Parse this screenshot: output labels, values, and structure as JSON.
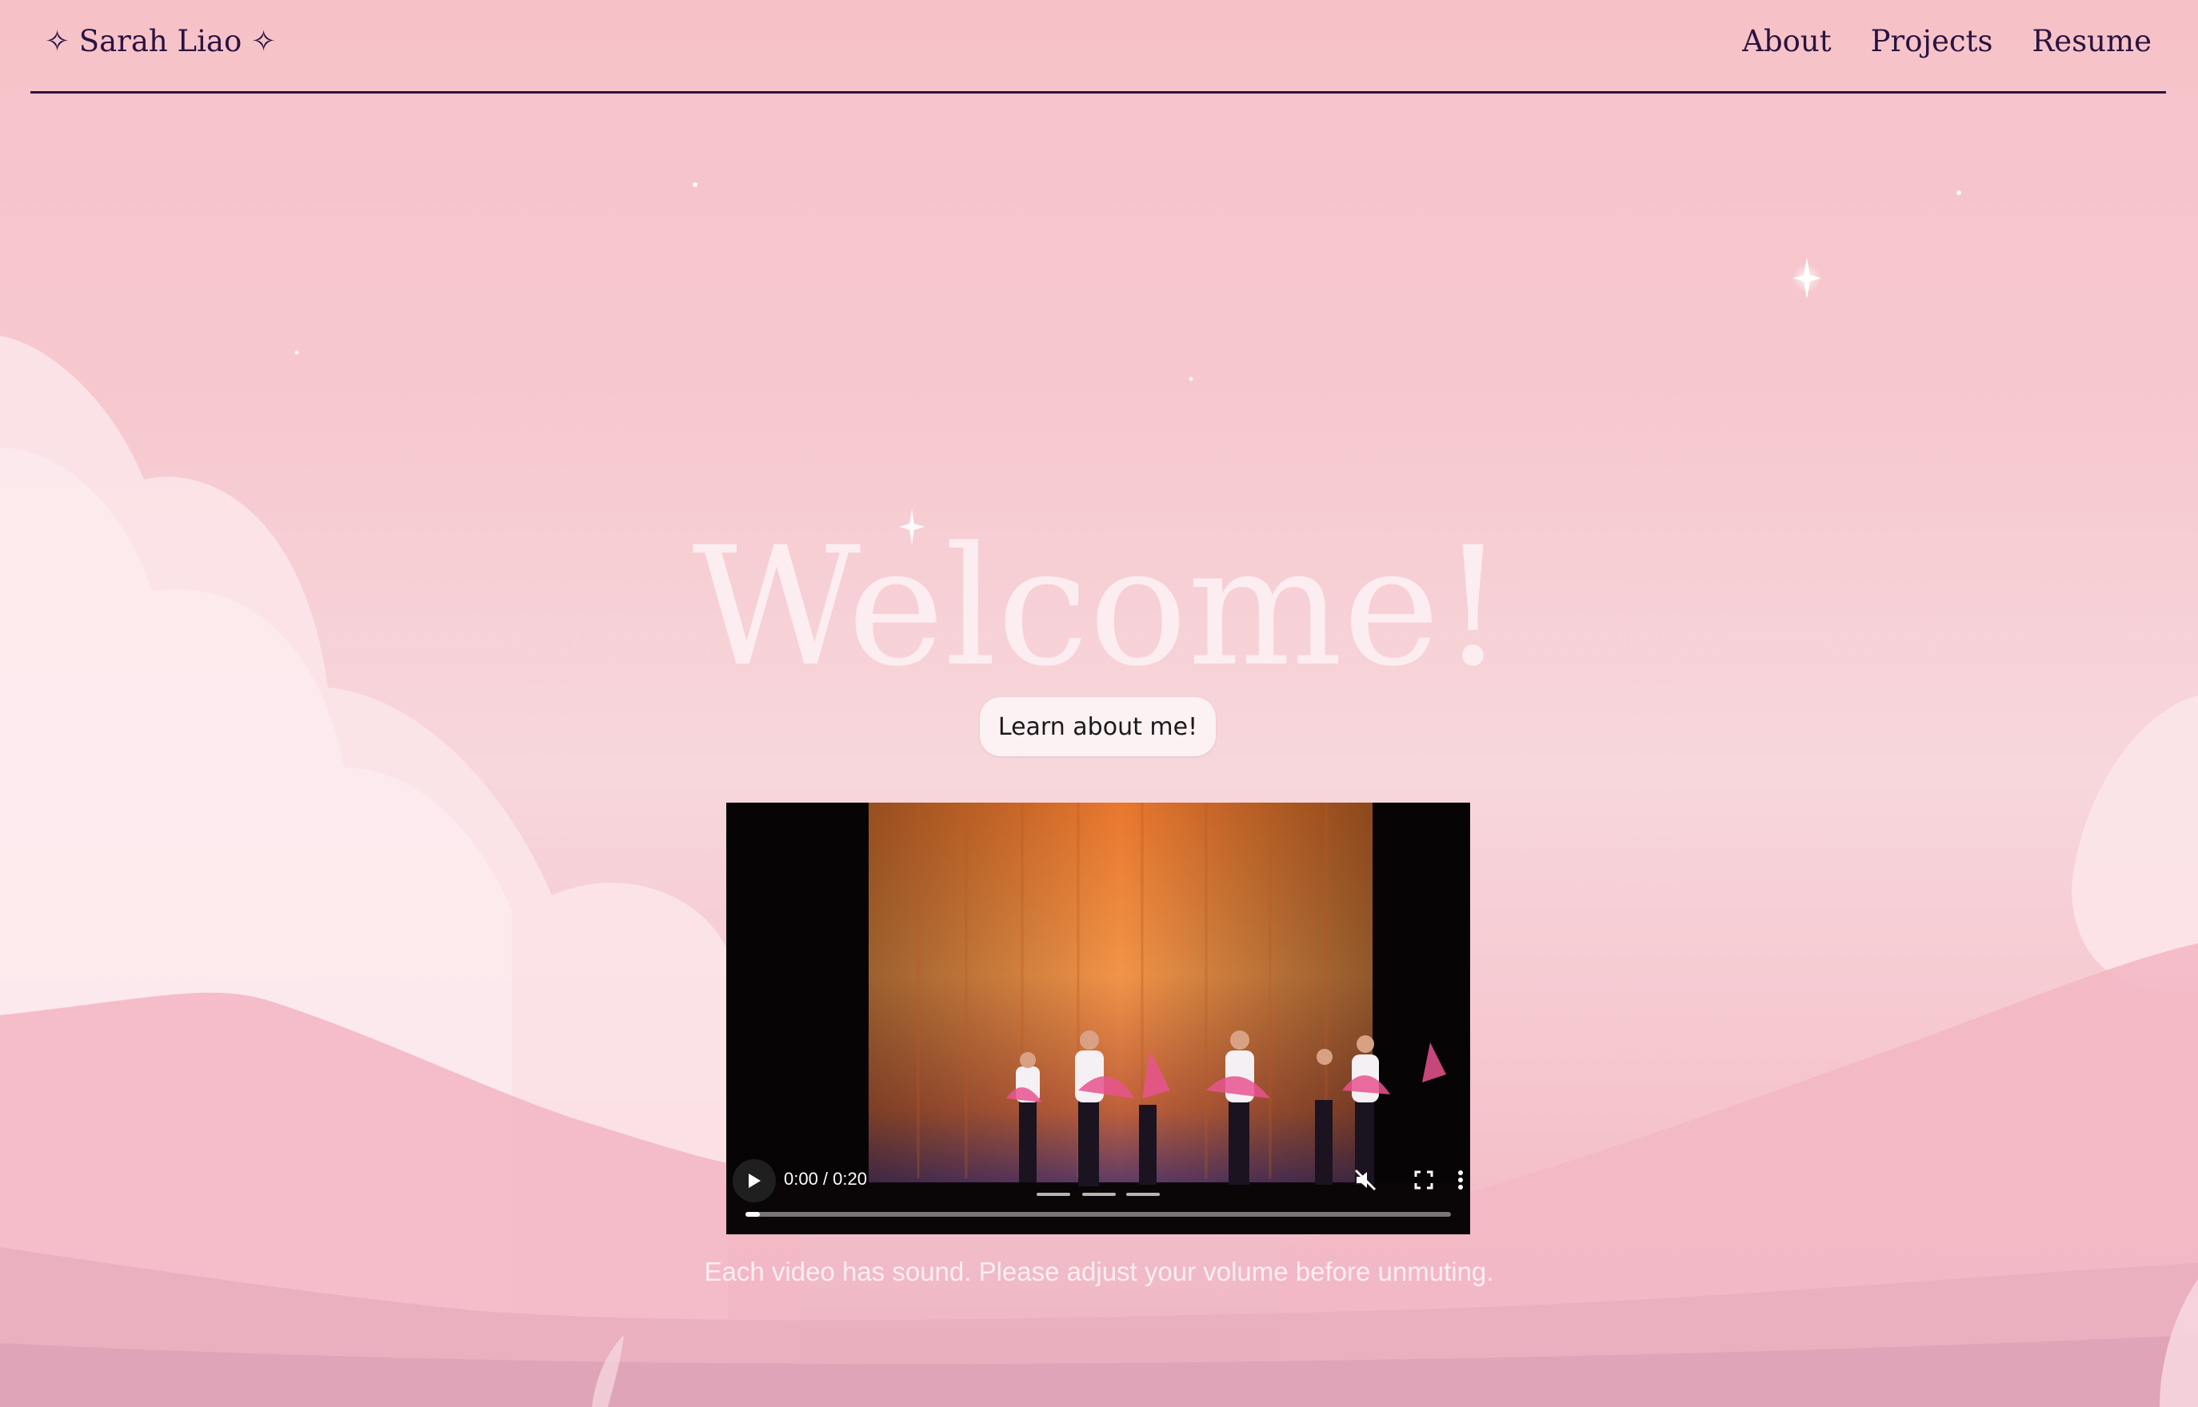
{
  "header": {
    "brand": "✧ Sarah Liao ✧",
    "nav": [
      {
        "label": "About"
      },
      {
        "label": "Projects"
      },
      {
        "label": "Resume"
      }
    ]
  },
  "hero": {
    "title": "Welcome!",
    "cta_label": "Learn about me!"
  },
  "video": {
    "time": "0:00 / 0:20",
    "progress": 0.02,
    "muted": true,
    "controls": [
      "play-icon",
      "mute-icon",
      "fullscreen-icon",
      "more-options-icon"
    ]
  },
  "note": "Each video has sound. Please adjust your volume before unmuting.",
  "colors": {
    "nav_text": "#2a1340",
    "background": "#f6c9cf",
    "title": "#fdf0f3"
  }
}
